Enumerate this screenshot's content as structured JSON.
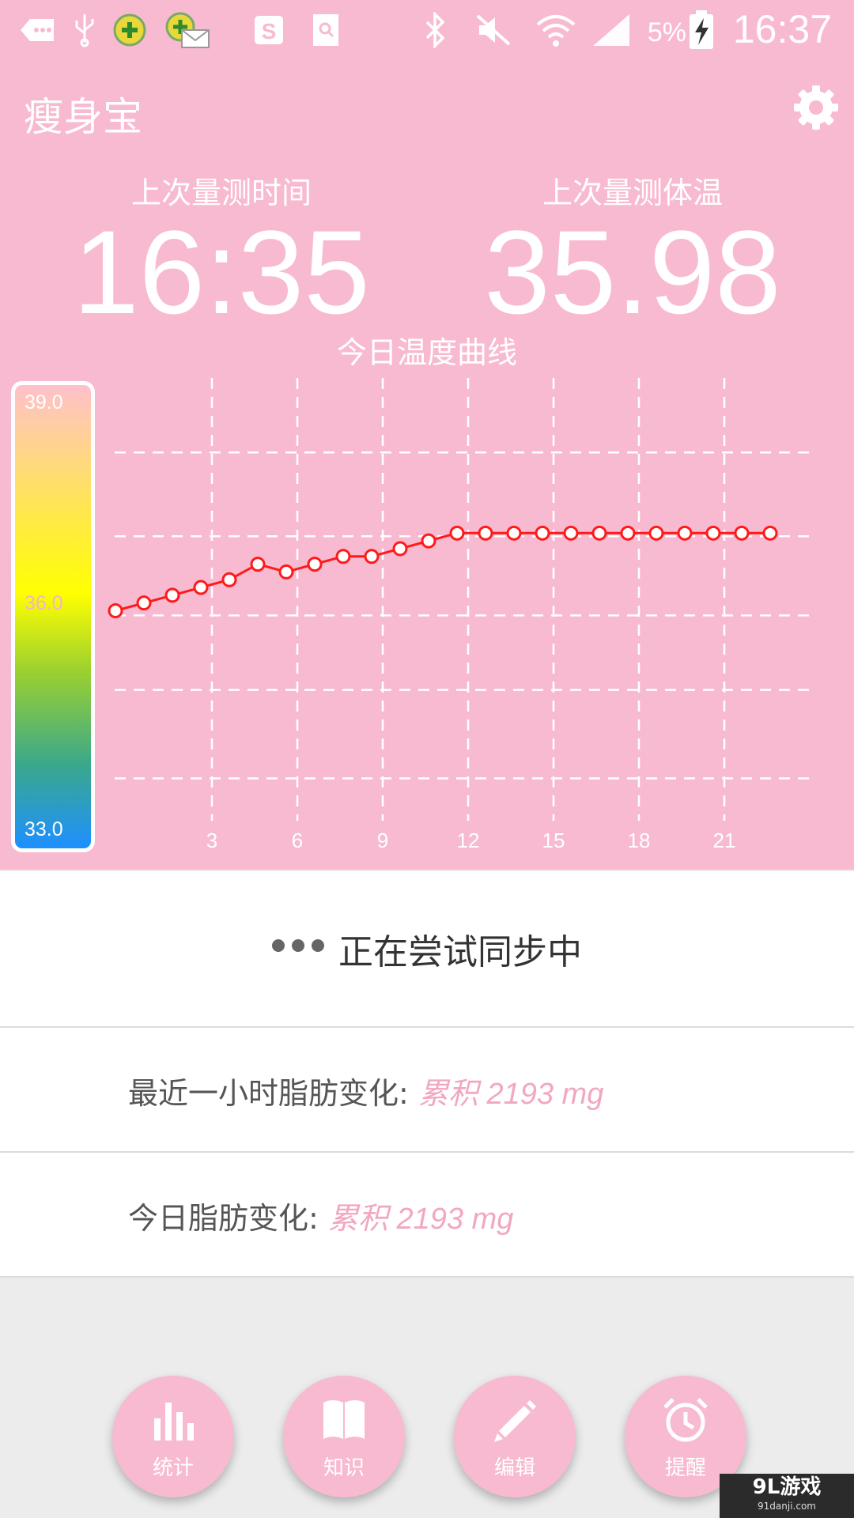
{
  "status_bar": {
    "battery_percent": "5%",
    "time": "16:37",
    "icons": [
      "back-icon",
      "usb-icon",
      "app-plus-icon",
      "app-mail-icon",
      "s-icon",
      "notes-icon",
      "bluetooth-icon",
      "mute-icon",
      "wifi-icon",
      "signal-icon",
      "battery-charging-icon"
    ]
  },
  "app_bar": {
    "title": "瘦身宝",
    "settings_icon": "gear-icon"
  },
  "last_measure": {
    "time_label": "上次量测时间",
    "time_value": "16:35",
    "temp_label": "上次量测体温",
    "temp_value": "35.98"
  },
  "chart_title": "今日温度曲线",
  "scale": {
    "top": "39.0",
    "middle": "36.0",
    "bottom": "33.0"
  },
  "chart_data": {
    "type": "line",
    "x_ticks": [
      "3",
      "6",
      "9",
      "12",
      "15",
      "18",
      "21"
    ],
    "xlim": [
      0,
      24
    ],
    "ylim": [
      33.0,
      39.0
    ],
    "grid": true,
    "series": [
      {
        "color": "#ff1a1a",
        "x": [
          0.5,
          1.5,
          2.5,
          3.5,
          4.5,
          5.5,
          6.5,
          7.5,
          8.5,
          9.5,
          10.5,
          11.5,
          12.5,
          13.5,
          14.5,
          15.5,
          16.5,
          17.5,
          18.5,
          19.5,
          20.5,
          21.5,
          22.5,
          23.5
        ],
        "y": [
          36.0,
          36.1,
          36.2,
          36.3,
          36.4,
          36.6,
          36.5,
          36.6,
          36.7,
          36.7,
          36.8,
          36.9,
          37.0,
          37.0,
          37.0,
          37.0,
          37.0,
          37.0,
          37.0,
          37.0,
          37.0,
          37.0,
          37.0,
          37.0
        ]
      }
    ]
  },
  "sync_status": "正在尝试同步中",
  "fat_hour": {
    "label": "最近一小时脂肪变化: ",
    "value": "累积 2193 mg"
  },
  "fat_today": {
    "label": "今日脂肪变化: ",
    "value": "累积 2193 mg"
  },
  "nav": [
    {
      "label": "统计",
      "icon": "bar-chart-icon"
    },
    {
      "label": "知识",
      "icon": "book-icon"
    },
    {
      "label": "编辑",
      "icon": "pencil-icon"
    },
    {
      "label": "提醒",
      "icon": "alarm-clock-icon"
    }
  ],
  "watermark": {
    "line1": "9L游戏",
    "line2": "91danji.com"
  },
  "colors": {
    "pink": "#f8bad0",
    "line_red": "#ff1a1a",
    "value_pink": "#f2a7c0"
  }
}
